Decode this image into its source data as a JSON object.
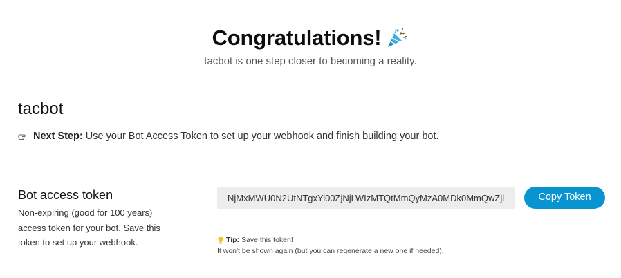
{
  "header": {
    "title": "Congratulations!",
    "subtitle": "tacbot is one step closer to becoming a reality.",
    "icon": "party-popper-icon"
  },
  "bot": {
    "name": "tacbot"
  },
  "next_step": {
    "icon": "pointing-hand-icon",
    "label": "Next Step:",
    "text": "Use your Bot Access Token to set up your webhook and finish building your bot."
  },
  "token": {
    "heading": "Bot access token",
    "description": "Non-expiring (good for 100 years) access token for your bot. Save this token to set up your webhook.",
    "value": "NjMxMWU0N2UtNTgxYi00ZjNjLWIzMTQtMmQyMzA0MDk0MmQwZjl",
    "copy_label": "Copy Token",
    "copy_color": "#0794d0"
  },
  "tip": {
    "icon": "lightbulb-icon",
    "label": "Tip:",
    "line1": "Save this token!",
    "line2": "It won't be shown again (but you can regenerate a new one if needed)."
  }
}
